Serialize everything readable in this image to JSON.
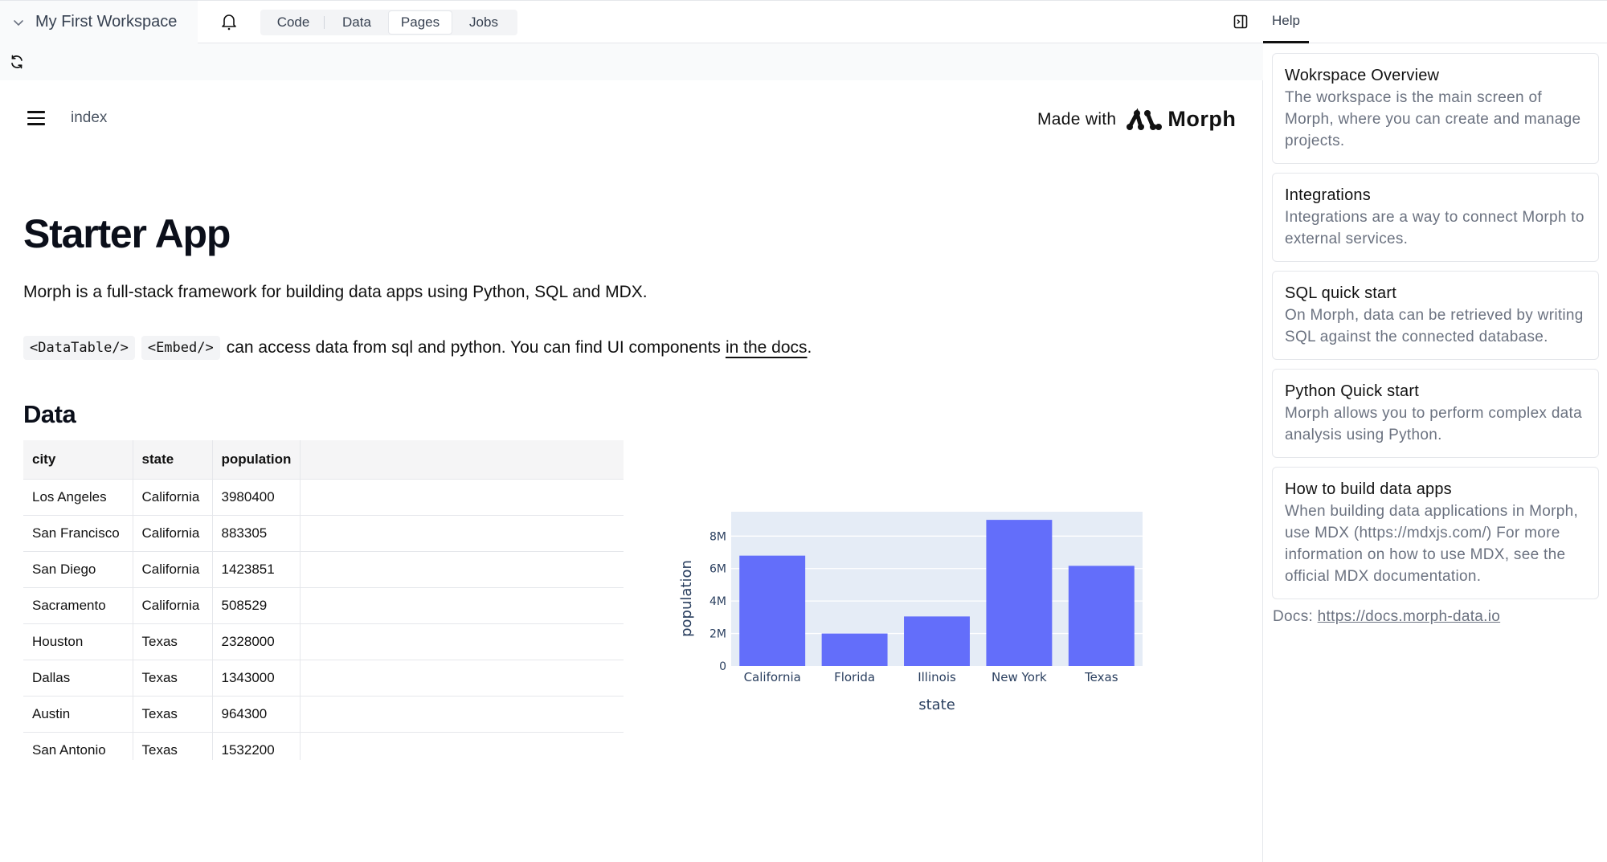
{
  "topbar": {
    "workspace_name": "My First Workspace",
    "tabs": [
      {
        "label": "Code",
        "active": false
      },
      {
        "label": "Data",
        "active": false
      },
      {
        "label": "Pages",
        "active": true
      },
      {
        "label": "Jobs",
        "active": false
      }
    ],
    "icons": {
      "workspace_toggle": "chevron-down-icon",
      "notifications": "bell-icon",
      "panel_toggle": "panel-right-icon",
      "refresh": "refresh-icon",
      "menu": "hamburger-icon"
    }
  },
  "page": {
    "breadcrumb": "index",
    "made_with_label": "Made with",
    "brand_name": "Morph",
    "title": "Starter App",
    "intro": "Morph is a full-stack framework for building data apps using Python, SQL and MDX.",
    "code_tags": [
      "<DataTable/>",
      "<Embed/>"
    ],
    "line2_text": "can access data from sql and python. You can find UI components",
    "docs_link_text": "in the docs",
    "line2_end": ".",
    "data_heading": "Data"
  },
  "table": {
    "columns": [
      "city",
      "state",
      "population"
    ],
    "rows": [
      [
        "Los Angeles",
        "California",
        "3980400"
      ],
      [
        "San Francisco",
        "California",
        "883305"
      ],
      [
        "San Diego",
        "California",
        "1423851"
      ],
      [
        "Sacramento",
        "California",
        "508529"
      ],
      [
        "Houston",
        "Texas",
        "2328000"
      ],
      [
        "Dallas",
        "Texas",
        "1343000"
      ],
      [
        "Austin",
        "Texas",
        "964300"
      ],
      [
        "San Antonio",
        "Texas",
        "1532200"
      ]
    ]
  },
  "chart_data": {
    "type": "bar",
    "title": "",
    "xlabel": "state",
    "ylabel": "population",
    "categories": [
      "California",
      "Florida",
      "Illinois",
      "New York",
      "Texas"
    ],
    "values": [
      6796085,
      2000000,
      3050000,
      9000000,
      6167500
    ],
    "ylim": [
      0,
      9500000
    ],
    "yticks": [
      0,
      2000000,
      4000000,
      6000000,
      8000000
    ],
    "ytick_labels": [
      "0",
      "2M",
      "4M",
      "6M",
      "8M"
    ],
    "grid": true,
    "bar_color": "#636efa",
    "plot_bg": "#e5ecf6"
  },
  "help": {
    "tab_label": "Help",
    "cards": [
      {
        "title": "Wokrspace Overview",
        "desc": "The workspace is the main screen of Morph, where you can create and manage projects."
      },
      {
        "title": "Integrations",
        "desc": "Integrations are a way to connect Morph to external services."
      },
      {
        "title": "SQL quick start",
        "desc": "On Morph, data can be retrieved by writing SQL against the connected database."
      },
      {
        "title": "Python Quick start",
        "desc": "Morph allows you to perform complex data analysis using Python."
      },
      {
        "title": "How to build data apps",
        "desc": "When building data applications in Morph, use MDX (https://mdxjs.com/) For more information on how to use MDX, see the official MDX documentation."
      }
    ],
    "docs_label": "Docs:",
    "docs_url": "https://docs.morph-data.io"
  }
}
